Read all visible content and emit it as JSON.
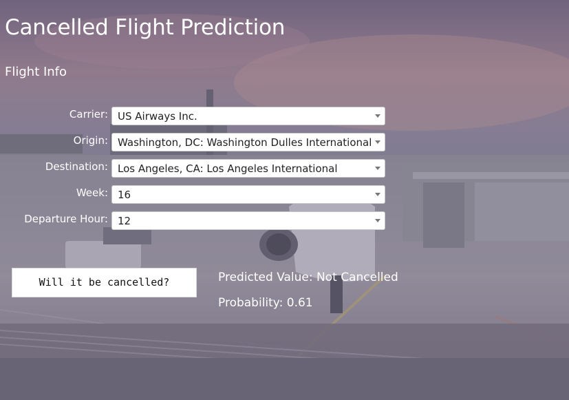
{
  "page": {
    "title": "Cancelled Flight Prediction",
    "section": "Flight Info"
  },
  "form": {
    "fields": [
      {
        "label": "Carrier:",
        "value": "US Airways Inc."
      },
      {
        "label": "Origin:",
        "value": "Washington, DC: Washington Dulles International"
      },
      {
        "label": "Destination:",
        "value": "Los Angeles, CA: Los Angeles International"
      },
      {
        "label": "Week:",
        "value": "16"
      },
      {
        "label": "Departure Hour:",
        "value": "12"
      }
    ],
    "submit_label": "Will it be cancelled?"
  },
  "result": {
    "prediction": "Predicted Value: Not Cancelled",
    "probability": "Probability: 0.61"
  },
  "colors": {
    "text": "#ffffff",
    "input_bg": "#ffffff",
    "input_text": "#222222"
  }
}
